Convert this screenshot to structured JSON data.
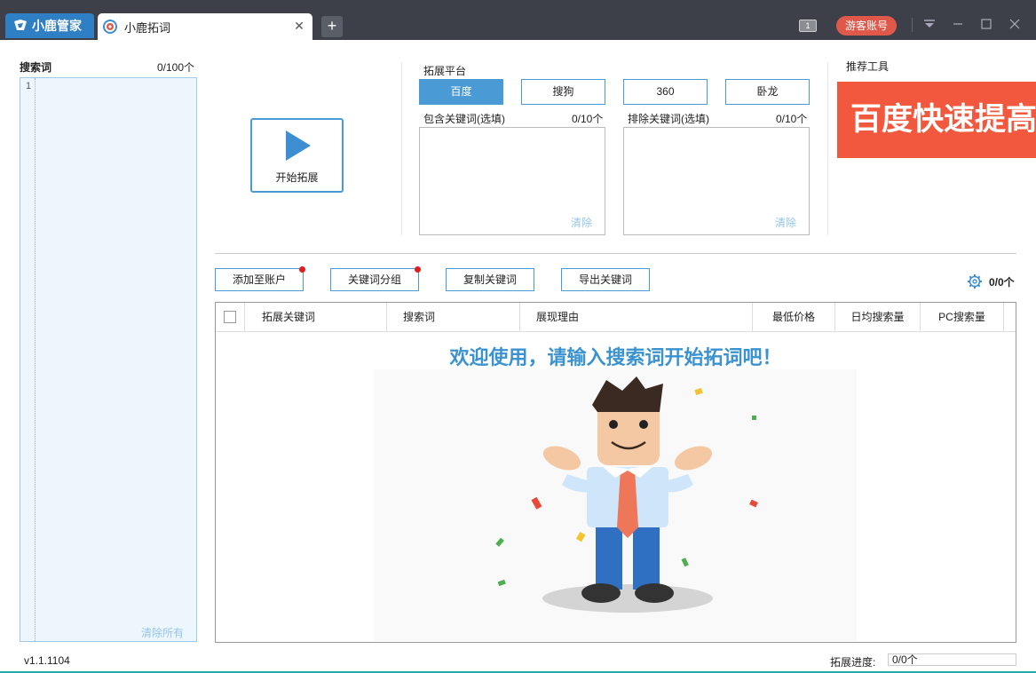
{
  "brand": {
    "name": "小鹿管家"
  },
  "tab": {
    "title": "小鹿拓词"
  },
  "header": {
    "notif_count": "1",
    "guest_button": "游客账号"
  },
  "left": {
    "search_label": "搜索词",
    "search_count": "0/100个",
    "line_number": "1",
    "clear_all": "清除所有"
  },
  "start": {
    "label": "开始拓展"
  },
  "platform": {
    "label": "拓展平台",
    "options": [
      "百度",
      "搜狗",
      "360",
      "卧龙"
    ],
    "selected": "百度"
  },
  "include": {
    "label": "包含关键词(选填)",
    "count": "0/10个",
    "clear": "清除"
  },
  "exclude": {
    "label": "排除关键词(选填)",
    "count": "0/10个",
    "clear": "清除"
  },
  "tools": {
    "label": "推荐工具",
    "promo_text": "百度快速提高"
  },
  "actions": [
    "添加至账户",
    "关键词分组",
    "复制关键词",
    "导出关键词"
  ],
  "result_count": "0/0个",
  "table": {
    "columns": [
      "拓展关键词",
      "搜索词",
      "展现理由",
      "最低价格",
      "日均搜索量",
      "PC搜索量"
    ],
    "welcome": "欢迎使用，请输入搜索词开始拓词吧！"
  },
  "footer": {
    "version": "v1.1.1104",
    "progress_label": "拓展进度:",
    "progress_text": "0/0个",
    "progress_fraction": 0
  },
  "colors": {
    "accent": "#4a9ad6",
    "promo_bg": "#f2583e",
    "titlebar": "#3d4048",
    "guest_btn": "#e0584a"
  }
}
